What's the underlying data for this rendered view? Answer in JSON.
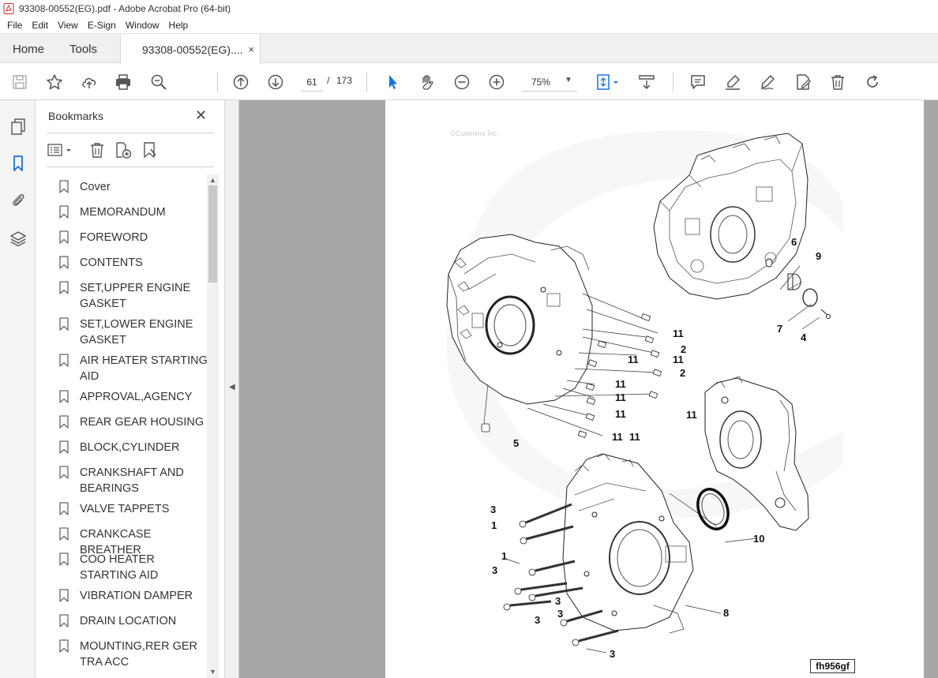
{
  "window": {
    "title": "93308-00552(EG).pdf - Adobe Acrobat Pro (64-bit)"
  },
  "menu": [
    "File",
    "Edit",
    "View",
    "E-Sign",
    "Window",
    "Help"
  ],
  "tabs": {
    "home": "Home",
    "tools": "Tools",
    "document": "93308-00552(EG)....",
    "close": "×"
  },
  "toolbar": {
    "current_page": "61",
    "page_separator": "/",
    "total_pages": "173",
    "zoom": "75%",
    "icons": [
      "save-icon",
      "star-icon",
      "upload-icon",
      "print-icon",
      "zoom-search-icon",
      "page-up-icon",
      "page-down-icon",
      "select-cursor-icon",
      "hand-icon",
      "zoom-out-icon",
      "zoom-in-icon",
      "fit-page-icon",
      "scroll-mode-icon",
      "comment-icon",
      "highlight-icon",
      "sign-icon",
      "fill-sign-icon",
      "delete-icon",
      "rotate-icon"
    ]
  },
  "left_rail": {
    "icons": [
      "page-thumbnails-icon",
      "bookmarks-icon",
      "attachments-icon",
      "layers-icon"
    ]
  },
  "bookmarks": {
    "title": "Bookmarks",
    "close": "✕",
    "items": [
      {
        "label": "Cover"
      },
      {
        "label": "MEMORANDUM"
      },
      {
        "label": "FOREWORD"
      },
      {
        "label": "CONTENTS"
      },
      {
        "label": "SET,UPPER ENGINE GASKET"
      },
      {
        "label": "SET,LOWER ENGINE GASKET"
      },
      {
        "label": "AIR HEATER STARTING AID"
      },
      {
        "label": "APPROVAL,AGENCY"
      },
      {
        "label": "REAR GEAR HOUSING"
      },
      {
        "label": "BLOCK,CYLINDER"
      },
      {
        "label": "CRANKSHAFT AND BEARINGS"
      },
      {
        "label": "VALVE TAPPETS"
      },
      {
        "label": "CRANKCASE BREATHER"
      },
      {
        "label": "COO HEATER STARTING AID"
      },
      {
        "label": "VIBRATION DAMPER"
      },
      {
        "label": "DRAIN LOCATION"
      },
      {
        "label": "MOUNTING,RER GER TRA ACC"
      }
    ]
  },
  "document": {
    "copyright": "©Cummins Inc",
    "figure_id": "fh956gf",
    "callouts": [
      "6",
      "9",
      "7",
      "4",
      "11",
      "2",
      "11",
      "11",
      "2",
      "11",
      "11",
      "11",
      "11",
      "11",
      "11",
      "5",
      "3",
      "1",
      "10",
      "1",
      "3",
      "3",
      "3",
      "8",
      "3",
      "3"
    ]
  }
}
